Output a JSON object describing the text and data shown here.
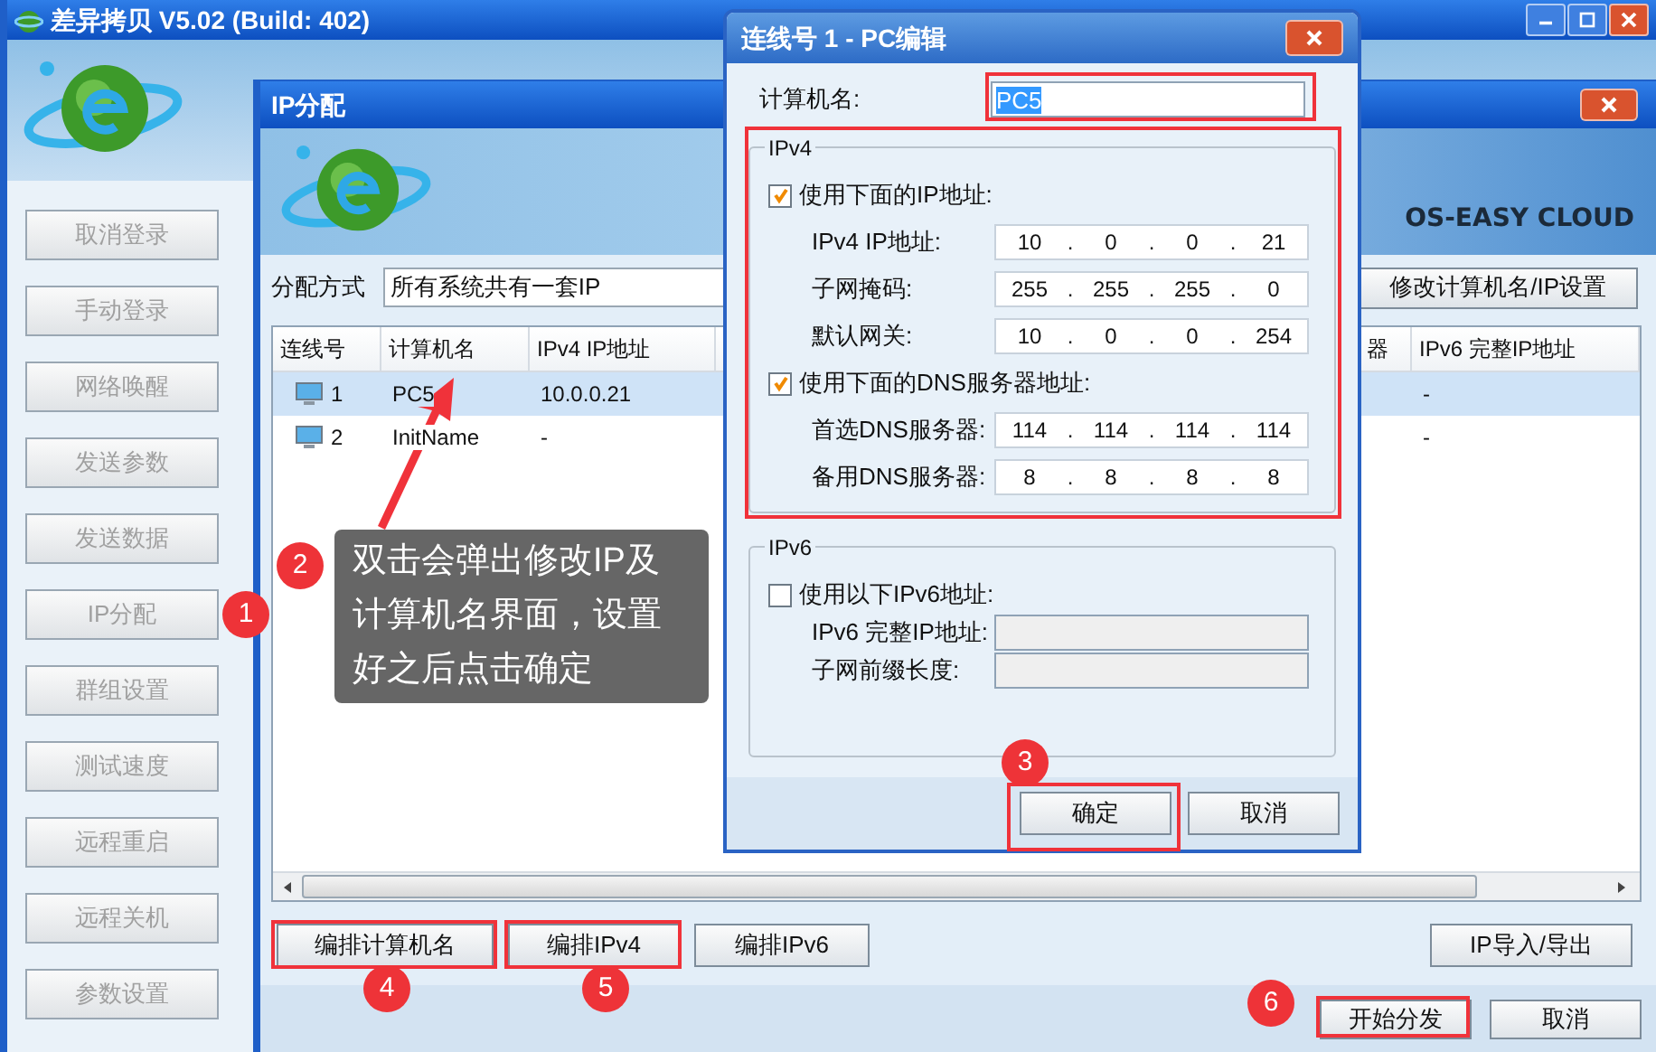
{
  "main_window": {
    "title": "差异拷贝 V5.02 (Build: 402)",
    "sidebar_buttons": [
      {
        "label": "取消登录",
        "disabled": true
      },
      {
        "label": "手动登录",
        "disabled": true
      },
      {
        "label": "网络唤醒",
        "disabled": true
      },
      {
        "label": "发送参数",
        "disabled": true
      },
      {
        "label": "发送数据",
        "disabled": true
      },
      {
        "label": "IP分配",
        "disabled": true
      },
      {
        "label": "群组设置",
        "disabled": true
      },
      {
        "label": "测试速度",
        "disabled": true
      },
      {
        "label": "远程重启",
        "disabled": true
      },
      {
        "label": "远程关机",
        "disabled": true
      },
      {
        "label": "参数设置",
        "disabled": true
      }
    ]
  },
  "ip_window": {
    "title": "IP分配",
    "brand": "OS-EASY CLOUD",
    "allocation_label": "分配方式",
    "allocation_value": "所有系统共有一套IP",
    "modify_button": "修改计算机名/IP设置",
    "table": {
      "columns": [
        "连线号",
        "计算机名",
        "IPv4 IP地址",
        "器",
        "IPv6 完整IP地址"
      ],
      "rows": [
        {
          "selected": true,
          "connection": "1",
          "computer_name": "PC5",
          "ipv4": "10.0.0.21",
          "ipv6": "-"
        },
        {
          "selected": false,
          "connection": "2",
          "computer_name": "InitName",
          "ipv4": "-",
          "ipv6": "-"
        }
      ]
    },
    "edit_buttons": [
      "编排计算机名",
      "编排IPv4",
      "编排IPv6"
    ],
    "import_button": "IP导入/导出",
    "footer_buttons": [
      "开始分发",
      "取消"
    ]
  },
  "dialog": {
    "title": "连线号 1 - PC编辑",
    "name_label": "计算机名:",
    "name_value": "PC5",
    "ip_separator": ".",
    "ipv4": {
      "legend": "IPv4",
      "use_ip": {
        "label": "使用下面的IP地址:",
        "checked": true
      },
      "ip_fields": [
        {
          "label": "IPv4 IP地址:",
          "segments": [
            "10",
            "0",
            "0",
            "21"
          ]
        },
        {
          "label": "子网掩码:",
          "segments": [
            "255",
            "255",
            "255",
            "0"
          ]
        },
        {
          "label": "默认网关:",
          "segments": [
            "10",
            "0",
            "0",
            "254"
          ]
        }
      ],
      "use_dns": {
        "label": "使用下面的DNS服务器地址:",
        "checked": true
      },
      "dns_fields": [
        {
          "label": "首选DNS服务器:",
          "segments": [
            "114",
            "114",
            "114",
            "114"
          ]
        },
        {
          "label": "备用DNS服务器:",
          "segments": [
            "8",
            "8",
            "8",
            "8"
          ]
        }
      ]
    },
    "ipv6": {
      "legend": "IPv6",
      "use_ipv6": {
        "label": "使用以下IPv6地址:",
        "checked": false
      },
      "field_labels": [
        "IPv6 完整IP地址:",
        "子网前缀长度:"
      ]
    },
    "buttons": [
      "确定",
      "取消"
    ]
  },
  "annotations": {
    "markers": [
      "1",
      "2",
      "3",
      "4",
      "5",
      "6"
    ],
    "tooltip": "双击会弹出修改IP及计算机名界面，设置好之后点击确定"
  }
}
